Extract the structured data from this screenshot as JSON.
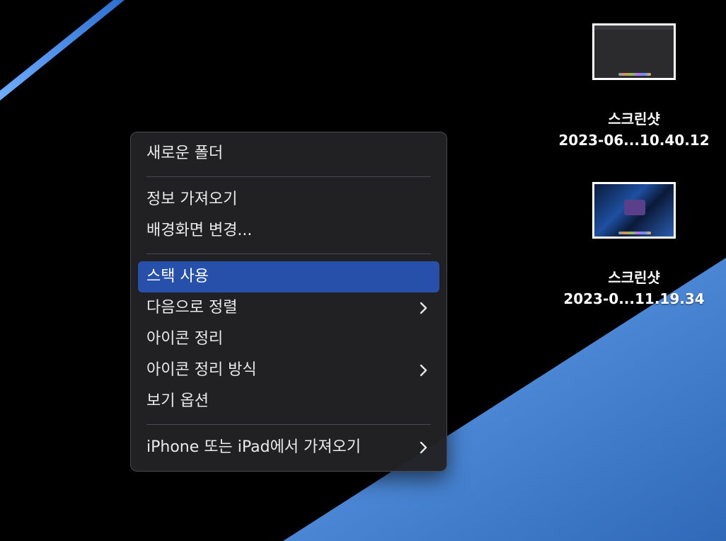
{
  "colors": {
    "menu_bg": "#222224",
    "highlight": "#2650aa",
    "wallpaper_blue": "#4a86d4",
    "desktop_bg": "#000000"
  },
  "desktop_icons": [
    {
      "label_line1": "스크린샷",
      "label_line2": "2023-06...10.40.12"
    },
    {
      "label_line1": "스크린샷",
      "label_line2": "2023-0...11.19.34"
    }
  ],
  "context_menu": {
    "new_folder": "새로운 폴더",
    "get_info": "정보 가져오기",
    "change_wallpaper": "배경화면 변경...",
    "use_stacks": "스택 사용",
    "sort_by": "다음으로 정렬",
    "clean_up": "아이콘 정리",
    "clean_up_by": "아이콘 정리 방식",
    "view_options": "보기 옵션",
    "import_from_iphone": "iPhone 또는 iPad에서 가져오기"
  }
}
